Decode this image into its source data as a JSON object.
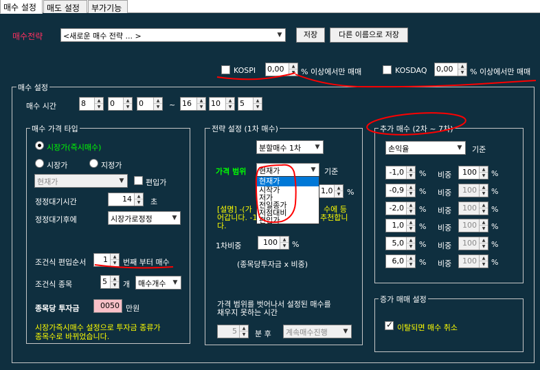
{
  "tabs": [
    {
      "label": "매수 설정",
      "active": true
    },
    {
      "label": "매도 설정",
      "active": false
    },
    {
      "label": "부가기능",
      "active": false
    }
  ],
  "strategy": {
    "label": "매수전략",
    "selected": "<새로운 매수 전략 ... >",
    "save_label": "저장",
    "save_as_label": "다른 이름으로 저장"
  },
  "market_filter": {
    "kospi_label": "KOSPI",
    "kospi_value": "0,00",
    "kospi_suffix": "% 이상에서만 매매",
    "kosdaq_label": "KOSDAQ",
    "kosdaq_value": "0,00",
    "kosdaq_suffix": "% 이상에서만 매매"
  },
  "buy_settings": {
    "group_label": "매수 설정",
    "time_label": "매수 시간",
    "start_h": "8",
    "start_m": "0",
    "start_s": "0",
    "tilde": "~",
    "end_h": "16",
    "end_m": "10",
    "end_s": "5"
  },
  "price_type": {
    "group_label": "매수 가격 타입",
    "market_now_label": "시장가(즉시매수)",
    "market_label": "시장가",
    "limit_label": "지정가",
    "price_combo": "현재가",
    "edit_price_label": "편입가",
    "wait_time_label": "정정대기시간",
    "wait_time_value": "14",
    "wait_time_unit": "초",
    "after_wait_label": "정정대기후에",
    "after_wait_value": "시장가로정정",
    "order_label": "조건식 편입순서",
    "order_value": "1",
    "order_suffix": "번째 부터 매수",
    "count_label": "조건식 종목",
    "count_value": "5",
    "count_unit": "개",
    "count_mode": "매수개수",
    "invest_label": "종목당 투자금",
    "invest_value": "0050",
    "invest_unit": "만원",
    "note_line1": "시장가즉시매수 설정으로 투자금 종류가",
    "note_line2": "종목수로 바뀌었습니다."
  },
  "strategy_setting": {
    "group_label": "전략 설정 (1차 매수)",
    "mode_value": "분할매수 1차",
    "range_label": "가격 범위",
    "range_value": "현재가",
    "range_suffix": "기준",
    "options": [
      "현재가",
      "시작가",
      "저가",
      "전일종가",
      "저점대비",
      "편입가"
    ],
    "pct_value": "1,0",
    "pct_unit": "%",
    "desc_line1_left": "[설명] -(가",
    "desc_line1_right": "수에 등",
    "desc_line2_left": "어갑니다. -1",
    "desc_line2_right": "추천합니",
    "desc_line3": "다.",
    "ratio_label": "1차비중",
    "ratio_value": "100",
    "ratio_unit": "%",
    "formula": "(종목당투자금 x 비중)",
    "timeout_line1": "가격 범위를 벗어나서 설정된 매수를",
    "timeout_line2": "채우지 못하는 시간",
    "timeout_value": "5",
    "timeout_unit": "분 후",
    "timeout_action": "계속매수진행"
  },
  "additional_buy": {
    "group_label": "추가 매수 (2차 ~ 7차)",
    "basis_value": "손익율",
    "basis_suffix": "기준",
    "weight_label": "비중",
    "pct_unit": "%",
    "rows": [
      {
        "pct": "-1,0",
        "weight": "100",
        "weight_enabled": true
      },
      {
        "pct": "-0,9",
        "weight": "100",
        "weight_enabled": false
      },
      {
        "pct": "-2,0",
        "weight": "100",
        "weight_enabled": false
      },
      {
        "pct": "1,0",
        "weight": "100",
        "weight_enabled": false
      },
      {
        "pct": "5,0",
        "weight": "100",
        "weight_enabled": false
      },
      {
        "pct": "6,0",
        "weight": "100",
        "weight_enabled": false
      }
    ]
  },
  "intraday": {
    "group_label": "증가 매매 설정",
    "cancel_label": "이탈되면 매수 취소"
  },
  "colors": {
    "background": "#0f2f3f",
    "highlight_text": "#ffff00",
    "green_text": "#00ff00",
    "strategy_label": "#ff3060",
    "annotation": "#ff0000"
  }
}
